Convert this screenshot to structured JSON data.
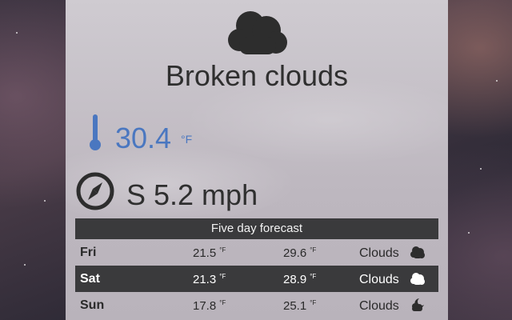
{
  "current": {
    "condition": "Broken clouds",
    "icon": "broken-clouds-icon",
    "temperature": "30.4",
    "temp_unit": "°F",
    "wind": "S 5.2 mph"
  },
  "forecast": {
    "title": "Five day forecast",
    "rows": [
      {
        "day": "Fri",
        "low": "21.5",
        "high": "29.6",
        "unit": "°F",
        "desc": "Clouds",
        "icon": "cloud-icon",
        "selected": false
      },
      {
        "day": "Sat",
        "low": "21.3",
        "high": "28.9",
        "unit": "°F",
        "desc": "Clouds",
        "icon": "cloud-icon",
        "selected": true
      },
      {
        "day": "Sun",
        "low": "17.8",
        "high": "25.1",
        "unit": "°F",
        "desc": "Clouds",
        "icon": "cloud-night-icon",
        "selected": false
      }
    ]
  },
  "colors": {
    "accent": "#4a77c0",
    "dark_bar": "#3a3a3c",
    "text": "#2f2f2f"
  }
}
